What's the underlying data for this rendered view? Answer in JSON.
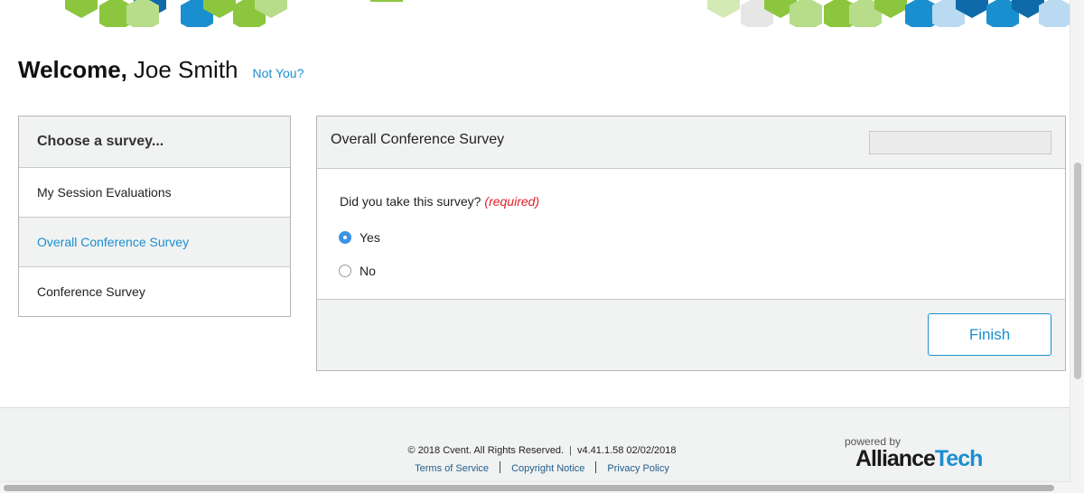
{
  "header": {
    "welcome_bold": "Welcome,",
    "user_name": "Joe Smith",
    "not_you_link": "Not You?"
  },
  "sidebar": {
    "heading": "Choose a survey...",
    "items": [
      {
        "label": "My Session Evaluations",
        "active": false
      },
      {
        "label": "Overall Conference Survey",
        "active": true
      },
      {
        "label": "Conference Survey",
        "active": false
      }
    ]
  },
  "survey": {
    "title": "Overall Conference Survey",
    "question": "Did you take this survey?",
    "required_label": "(required)",
    "options": [
      {
        "label": "Yes",
        "selected": true
      },
      {
        "label": "No",
        "selected": false
      }
    ],
    "finish_label": "Finish"
  },
  "footer": {
    "copyright": "© 2018 Cvent. All Rights Reserved.",
    "version": "v4.41.1.58 02/02/2018",
    "links": [
      "Terms of Service",
      "Copyright Notice",
      "Privacy Policy"
    ],
    "powered_by": "powered by",
    "brand_part1": "Alliance",
    "brand_part2": "Tech"
  },
  "colors": {
    "accent_blue": "#1a8fd0",
    "required_red": "#e0202a",
    "panel_gray": "#f1f2f2",
    "hex_green": "#8cc63f",
    "hex_blue": "#1a8fd0",
    "hex_dark_blue": "#0e6aa8"
  }
}
